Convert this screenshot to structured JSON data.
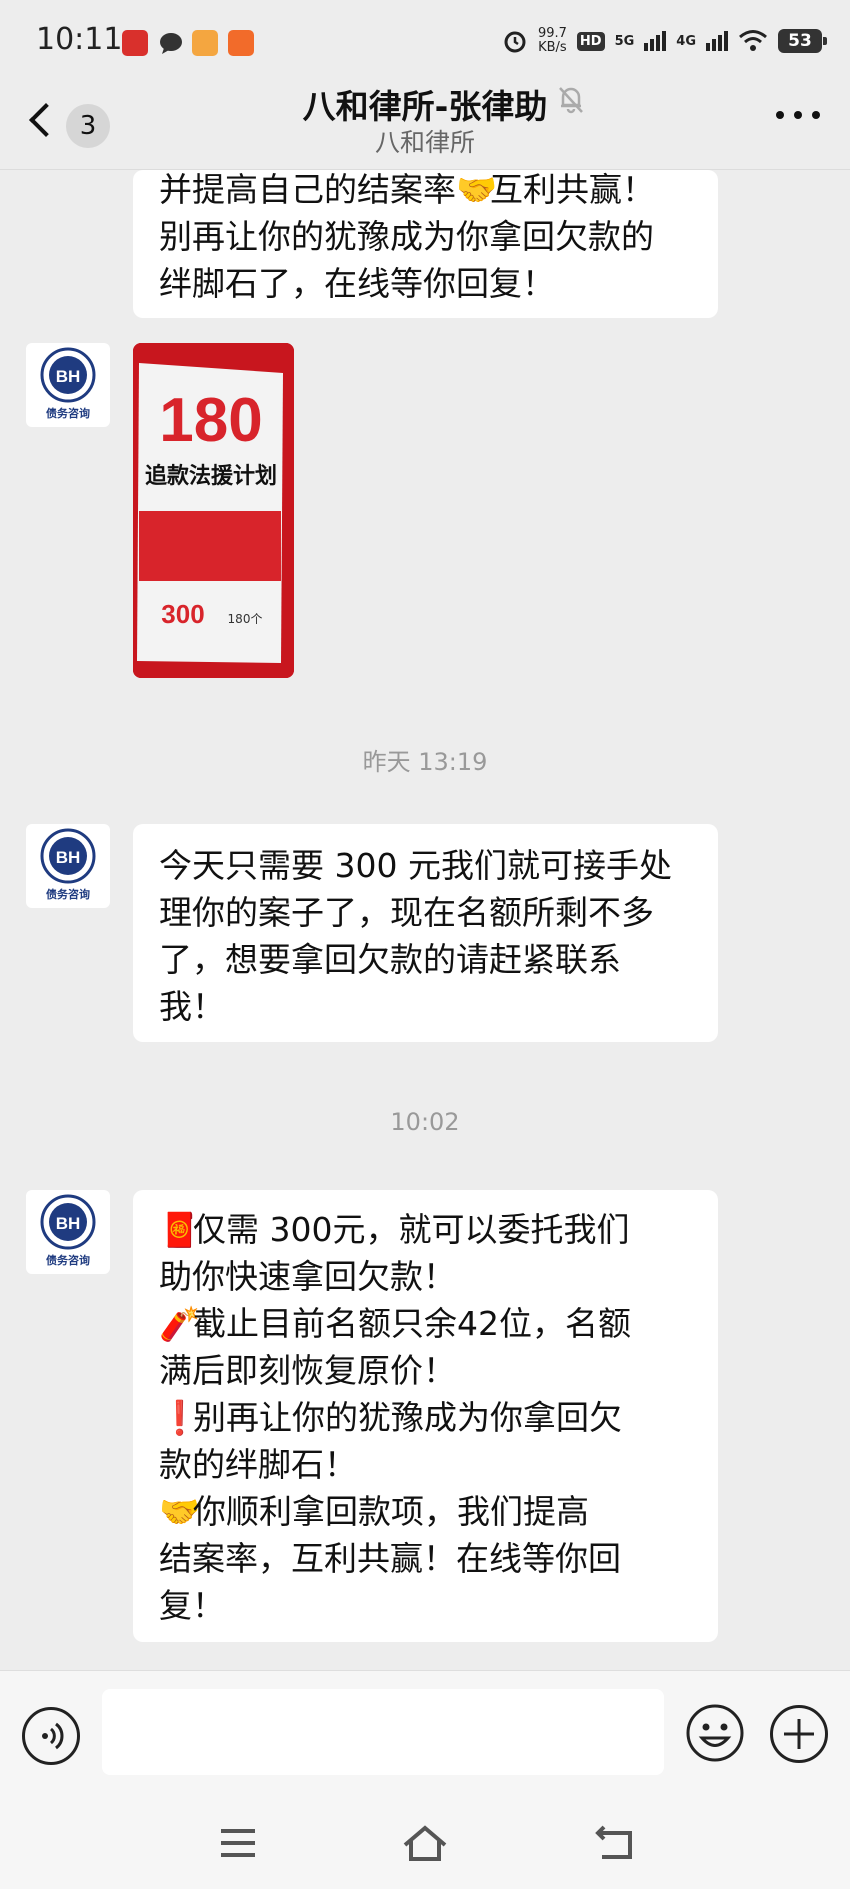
{
  "status_bar": {
    "time": "10:11",
    "net_speed_value": "99.7",
    "net_speed_unit": "KB/s",
    "hd_label": "HD",
    "network_a": "5G",
    "network_b": "4G",
    "battery": "53",
    "icons": [
      "news-app-icon",
      "chat-bubble-icon",
      "cartoon-app-icon",
      "delivery-app-icon",
      "alarm-icon",
      "wifi-icon"
    ]
  },
  "header": {
    "back_badge_count": "3",
    "title": "八和律所-张律助",
    "subtitle": "八和律所",
    "mute_icon": "bell-muted-icon",
    "more_icon": "more-dots-icon"
  },
  "messages": [
    {
      "type": "text",
      "segments": [
        {
          "text": "并提高自己的结案率"
        },
        {
          "emoji": "🤝"
        },
        {
          "text": "互利共赢！\n别再让你的犹豫成为你拿回欠款的\n绊脚石了，在线等你回复！"
        }
      ]
    },
    {
      "type": "image",
      "avatar_label": "债务咨询",
      "poster": {
        "top_text": "180",
        "headline": "追款法援计划",
        "price": "300",
        "note": "180个"
      }
    },
    {
      "type": "timestamp",
      "text": "昨天 13:19"
    },
    {
      "type": "text",
      "avatar_label": "债务咨询",
      "segments": [
        {
          "text": "今天只需要 300 元我们就可接手处\n理你的案子了，现在名额所剩不多\n了，想要拿回欠款的请赶紧联系\n我！"
        }
      ]
    },
    {
      "type": "timestamp",
      "text": "10:02"
    },
    {
      "type": "text",
      "avatar_label": "债务咨询",
      "segments": [
        {
          "emoji": "🧧"
        },
        {
          "text": "仅需 300元，就可以委托我们\n助你快速拿回欠款！\n"
        },
        {
          "emoji": "🧨"
        },
        {
          "text": "截止目前名额只余42位，名额\n满后即刻恢复原价！\n"
        },
        {
          "emoji": "❗"
        },
        {
          "text": "别再让你的犹豫成为你拿回欠\n款的绊脚石！\n"
        },
        {
          "emoji": "🤝"
        },
        {
          "text": "你顺利拿回款项，我们提高\n结案率，互利共赢！在线等你回\n复！"
        }
      ]
    }
  ],
  "input_bar": {
    "voice_icon": "voice-icon",
    "emoji_icon": "emoji-smile-icon",
    "plus_icon": "plus-icon"
  },
  "system_nav": {
    "icons": [
      "menu-icon",
      "home-icon",
      "back-icon"
    ]
  },
  "colors": {
    "background": "#ededed",
    "bubble": "#ffffff",
    "poster_red": "#c8161e",
    "avatar_blue": "#1f3b80"
  }
}
